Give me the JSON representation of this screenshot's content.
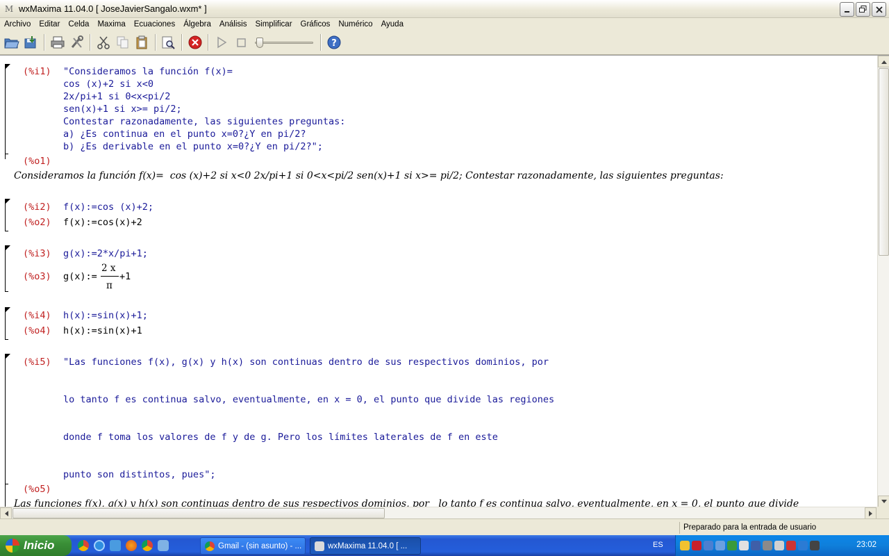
{
  "window": {
    "title": "wxMaxima 11.04.0  [ JoseJavierSangalo.wxm* ]",
    "icon": "maxima-app-icon"
  },
  "menu": [
    "Archivo",
    "Editar",
    "Celda",
    "Maxima",
    "Ecuaciones",
    "Álgebra",
    "Análisis",
    "Simplificar",
    "Gráficos",
    "Numérico",
    "Ayuda"
  ],
  "toolbar": {
    "icons": [
      "open-folder-icon",
      "save-icon",
      "print-icon",
      "preferences-icon",
      "cut-icon",
      "copy-icon",
      "paste-icon",
      "find-icon",
      "interrupt-icon",
      "play-icon",
      "stop-icon",
      "animation-slider",
      "help-icon"
    ]
  },
  "cells": [
    {
      "in_label": "(%i1)",
      "in_lines": [
        "\"Consideramos la función f(x)=",
        "cos (x)+2 si x<0",
        "2x/pi+1 si 0<x<pi/2",
        "sen(x)+1 si x>= pi/2;",
        "Contestar razonadamente, las siguientes preguntas:",
        "a) ¿Es continua en el punto x=0?¿Y en pi/2?",
        "b) ¿Es derivable en el punto x=0?¿Y en pi/2?\";"
      ],
      "out_label": "(%o1)",
      "out_text": "Consideramos la función f(x)=  cos (x)+2 si x<0 2x/pi+1 si 0<x<pi/2 sen(x)+1 si x>= pi/2; Contestar razonadamente, las siguientes preguntas:"
    },
    {
      "in_label": "(%i2)",
      "in_text": "f(x):=cos (x)+2;",
      "out_label": "(%o2)",
      "out_text": "f(x):=cos(x)+2"
    },
    {
      "in_label": "(%i3)",
      "in_text": "g(x):=2*x/pi+1;",
      "out_label": "(%o3)",
      "out_prefix": "g(x):=",
      "out_numerator": "2 x",
      "out_denominator": "π",
      "out_suffix": "+1"
    },
    {
      "in_label": "(%i4)",
      "in_text": "h(x):=sin(x)+1;",
      "out_label": "(%o4)",
      "out_text": "h(x):=sin(x)+1"
    },
    {
      "in_label": "(%i5)",
      "in_lines": [
        "\"Las funciones f(x), g(x) y h(x) son continuas dentro de sus respectivos dominios, por",
        "lo tanto f es continua salvo, eventualmente, en x = 0, el punto que divide las regiones",
        "donde f toma los valores de f y de g. Pero los límites laterales de f en este",
        "punto son distintos, pues\";"
      ],
      "out_label": "(%o5)",
      "out_text": "Las funciones f(x), g(x) y h(x) son continuas dentro de sus respectivos dominios, por   lo tanto f es continua salvo, eventualmente, en x = 0, el punto que divide"
    }
  ],
  "status": "Preparado para la entrada de usuario",
  "taskbar": {
    "start_label": "Inicio",
    "tasks": [
      "Gmail - (sin asunto) - ...",
      "wxMaxima 11.04.0  [ ..."
    ],
    "language": "ES",
    "clock": "23:02"
  },
  "colors": {
    "input_text": "#1a1a99",
    "label_text": "#c02020",
    "taskbar_blue": "#245edb",
    "start_green": "#3a8f37"
  }
}
